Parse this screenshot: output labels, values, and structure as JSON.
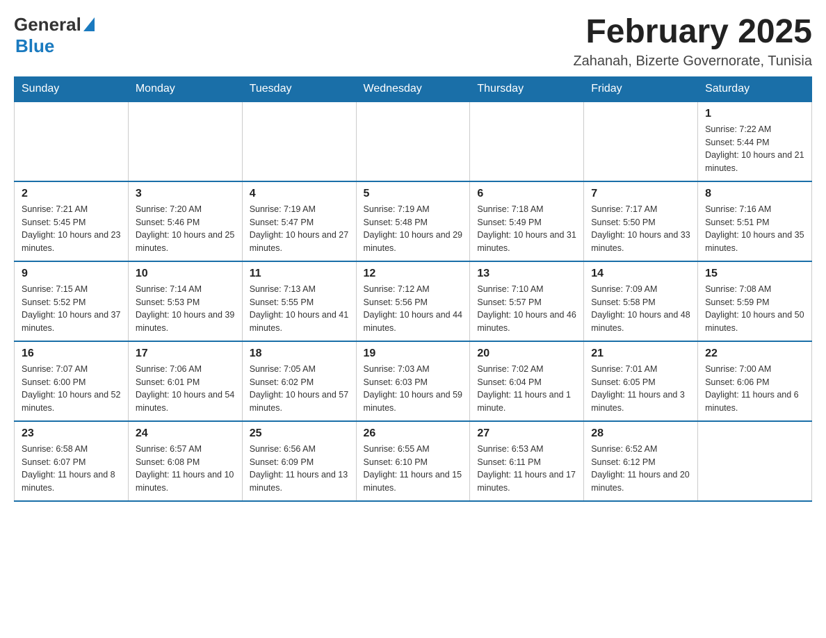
{
  "header": {
    "logo_general": "General",
    "logo_blue": "Blue",
    "month_title": "February 2025",
    "subtitle": "Zahanah, Bizerte Governorate, Tunisia"
  },
  "weekdays": [
    "Sunday",
    "Monday",
    "Tuesday",
    "Wednesday",
    "Thursday",
    "Friday",
    "Saturday"
  ],
  "weeks": [
    [
      {
        "day": "",
        "sunrise": "",
        "sunset": "",
        "daylight": ""
      },
      {
        "day": "",
        "sunrise": "",
        "sunset": "",
        "daylight": ""
      },
      {
        "day": "",
        "sunrise": "",
        "sunset": "",
        "daylight": ""
      },
      {
        "day": "",
        "sunrise": "",
        "sunset": "",
        "daylight": ""
      },
      {
        "day": "",
        "sunrise": "",
        "sunset": "",
        "daylight": ""
      },
      {
        "day": "",
        "sunrise": "",
        "sunset": "",
        "daylight": ""
      },
      {
        "day": "1",
        "sunrise": "Sunrise: 7:22 AM",
        "sunset": "Sunset: 5:44 PM",
        "daylight": "Daylight: 10 hours and 21 minutes."
      }
    ],
    [
      {
        "day": "2",
        "sunrise": "Sunrise: 7:21 AM",
        "sunset": "Sunset: 5:45 PM",
        "daylight": "Daylight: 10 hours and 23 minutes."
      },
      {
        "day": "3",
        "sunrise": "Sunrise: 7:20 AM",
        "sunset": "Sunset: 5:46 PM",
        "daylight": "Daylight: 10 hours and 25 minutes."
      },
      {
        "day": "4",
        "sunrise": "Sunrise: 7:19 AM",
        "sunset": "Sunset: 5:47 PM",
        "daylight": "Daylight: 10 hours and 27 minutes."
      },
      {
        "day": "5",
        "sunrise": "Sunrise: 7:19 AM",
        "sunset": "Sunset: 5:48 PM",
        "daylight": "Daylight: 10 hours and 29 minutes."
      },
      {
        "day": "6",
        "sunrise": "Sunrise: 7:18 AM",
        "sunset": "Sunset: 5:49 PM",
        "daylight": "Daylight: 10 hours and 31 minutes."
      },
      {
        "day": "7",
        "sunrise": "Sunrise: 7:17 AM",
        "sunset": "Sunset: 5:50 PM",
        "daylight": "Daylight: 10 hours and 33 minutes."
      },
      {
        "day": "8",
        "sunrise": "Sunrise: 7:16 AM",
        "sunset": "Sunset: 5:51 PM",
        "daylight": "Daylight: 10 hours and 35 minutes."
      }
    ],
    [
      {
        "day": "9",
        "sunrise": "Sunrise: 7:15 AM",
        "sunset": "Sunset: 5:52 PM",
        "daylight": "Daylight: 10 hours and 37 minutes."
      },
      {
        "day": "10",
        "sunrise": "Sunrise: 7:14 AM",
        "sunset": "Sunset: 5:53 PM",
        "daylight": "Daylight: 10 hours and 39 minutes."
      },
      {
        "day": "11",
        "sunrise": "Sunrise: 7:13 AM",
        "sunset": "Sunset: 5:55 PM",
        "daylight": "Daylight: 10 hours and 41 minutes."
      },
      {
        "day": "12",
        "sunrise": "Sunrise: 7:12 AM",
        "sunset": "Sunset: 5:56 PM",
        "daylight": "Daylight: 10 hours and 44 minutes."
      },
      {
        "day": "13",
        "sunrise": "Sunrise: 7:10 AM",
        "sunset": "Sunset: 5:57 PM",
        "daylight": "Daylight: 10 hours and 46 minutes."
      },
      {
        "day": "14",
        "sunrise": "Sunrise: 7:09 AM",
        "sunset": "Sunset: 5:58 PM",
        "daylight": "Daylight: 10 hours and 48 minutes."
      },
      {
        "day": "15",
        "sunrise": "Sunrise: 7:08 AM",
        "sunset": "Sunset: 5:59 PM",
        "daylight": "Daylight: 10 hours and 50 minutes."
      }
    ],
    [
      {
        "day": "16",
        "sunrise": "Sunrise: 7:07 AM",
        "sunset": "Sunset: 6:00 PM",
        "daylight": "Daylight: 10 hours and 52 minutes."
      },
      {
        "day": "17",
        "sunrise": "Sunrise: 7:06 AM",
        "sunset": "Sunset: 6:01 PM",
        "daylight": "Daylight: 10 hours and 54 minutes."
      },
      {
        "day": "18",
        "sunrise": "Sunrise: 7:05 AM",
        "sunset": "Sunset: 6:02 PM",
        "daylight": "Daylight: 10 hours and 57 minutes."
      },
      {
        "day": "19",
        "sunrise": "Sunrise: 7:03 AM",
        "sunset": "Sunset: 6:03 PM",
        "daylight": "Daylight: 10 hours and 59 minutes."
      },
      {
        "day": "20",
        "sunrise": "Sunrise: 7:02 AM",
        "sunset": "Sunset: 6:04 PM",
        "daylight": "Daylight: 11 hours and 1 minute."
      },
      {
        "day": "21",
        "sunrise": "Sunrise: 7:01 AM",
        "sunset": "Sunset: 6:05 PM",
        "daylight": "Daylight: 11 hours and 3 minutes."
      },
      {
        "day": "22",
        "sunrise": "Sunrise: 7:00 AM",
        "sunset": "Sunset: 6:06 PM",
        "daylight": "Daylight: 11 hours and 6 minutes."
      }
    ],
    [
      {
        "day": "23",
        "sunrise": "Sunrise: 6:58 AM",
        "sunset": "Sunset: 6:07 PM",
        "daylight": "Daylight: 11 hours and 8 minutes."
      },
      {
        "day": "24",
        "sunrise": "Sunrise: 6:57 AM",
        "sunset": "Sunset: 6:08 PM",
        "daylight": "Daylight: 11 hours and 10 minutes."
      },
      {
        "day": "25",
        "sunrise": "Sunrise: 6:56 AM",
        "sunset": "Sunset: 6:09 PM",
        "daylight": "Daylight: 11 hours and 13 minutes."
      },
      {
        "day": "26",
        "sunrise": "Sunrise: 6:55 AM",
        "sunset": "Sunset: 6:10 PM",
        "daylight": "Daylight: 11 hours and 15 minutes."
      },
      {
        "day": "27",
        "sunrise": "Sunrise: 6:53 AM",
        "sunset": "Sunset: 6:11 PM",
        "daylight": "Daylight: 11 hours and 17 minutes."
      },
      {
        "day": "28",
        "sunrise": "Sunrise: 6:52 AM",
        "sunset": "Sunset: 6:12 PM",
        "daylight": "Daylight: 11 hours and 20 minutes."
      },
      {
        "day": "",
        "sunrise": "",
        "sunset": "",
        "daylight": ""
      }
    ]
  ]
}
